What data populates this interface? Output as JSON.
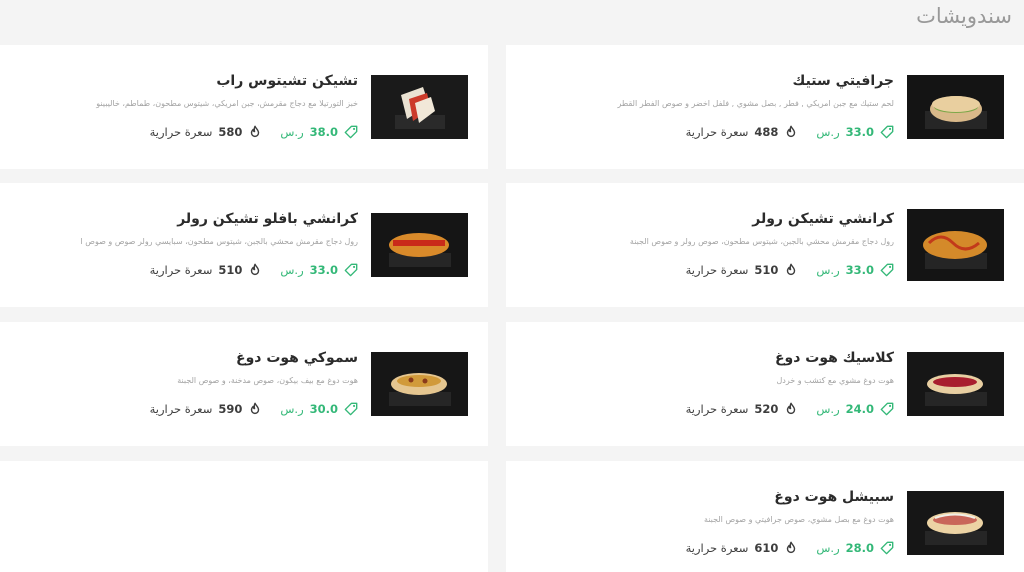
{
  "section": {
    "title": "سندويشات"
  },
  "currency": "ر.س",
  "calorie_label": "سعرة حرارية",
  "items": [
    {
      "name": "جرافيتي ستيك",
      "desc": "لحم ستيك مع جبن امريكي , فطر , بصل مشوي , فلفل اخضر و صوص الفطر القطر",
      "price": "33.0",
      "calories": "488"
    },
    {
      "name": "تشيكن تشيتوس راب",
      "desc": "خبز التورتيلا مع دجاج مقرمش، جبن امريكي، شيتوس مطحون، طماطم، خاليبينو",
      "price": "38.0",
      "calories": "580"
    },
    {
      "name": "كرانشي تشيكن رولر",
      "desc": "رول دجاج مقرمش محشي بالجبن، شيتوس مطحون، صوص رولر و صوص الجبنة",
      "price": "33.0",
      "calories": "510"
    },
    {
      "name": "كرانشي بافلو تشيكن رولر",
      "desc": "رول دجاج مقرمش محشي بالجبن، شيتوس مطحون، سبايسي رولر صوص و صوص ا",
      "price": "33.0",
      "calories": "510"
    },
    {
      "name": "كلاسيك هوت دوغ",
      "desc": "هوت دوغ مشوي مع كتشب و خردل",
      "price": "24.0",
      "calories": "520"
    },
    {
      "name": "سموكي هوت دوغ",
      "desc": "هوت دوغ مع بيف بيكون، صوص مدخنة، و صوص الجبنة",
      "price": "30.0",
      "calories": "590"
    },
    {
      "name": "سبيشل هوت دوغ",
      "desc": "هوت دوغ مع بصل مشوي، صوص جرافيتي و صوص الجبنة",
      "price": "28.0",
      "calories": "610"
    }
  ],
  "colors": {
    "price": "#34b878",
    "title": "#2b2b2b",
    "desc": "#a3a3a3",
    "background": "#f4f4f4"
  }
}
